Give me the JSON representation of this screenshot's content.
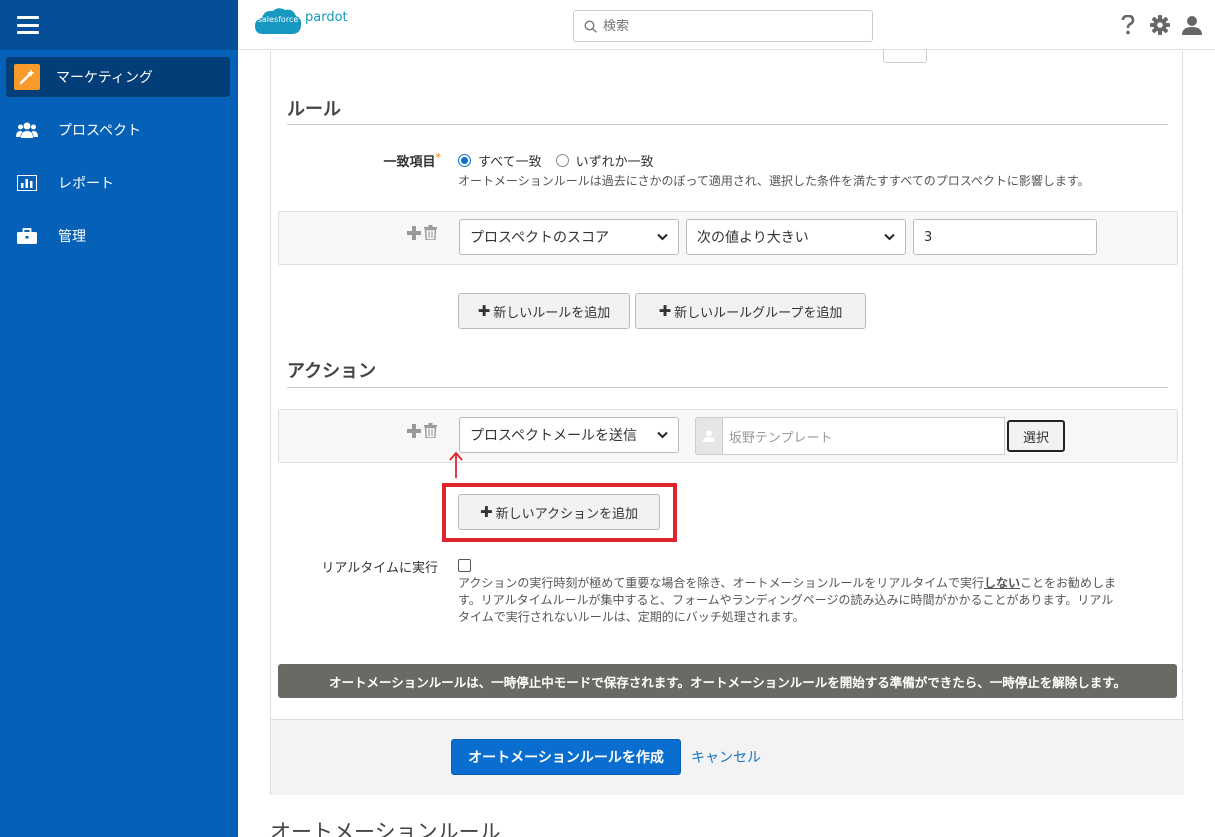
{
  "sidebar": {
    "items": [
      {
        "label": "マーケティング",
        "icon": "magic-wand-icon",
        "active": true
      },
      {
        "label": "プロスペクト",
        "icon": "users-icon",
        "active": false
      },
      {
        "label": "レポート",
        "icon": "bar-chart-icon",
        "active": false
      },
      {
        "label": "管理",
        "icon": "briefcase-icon",
        "active": false
      }
    ]
  },
  "header": {
    "logo_cloud": "salesforce",
    "logo_product": "pardot",
    "search_placeholder": "検索"
  },
  "rules": {
    "title": "ルール",
    "match_label": "一致項目",
    "match_required_mark": "*",
    "match_all": "すべて一致",
    "match_any": "いずれか一致",
    "match_help": "オートメーションルールは過去にさかのぼって適用され、選択した条件を満たすすべてのプロスペクトに影響します。",
    "rule_field": "プロスペクトのスコア",
    "rule_operator": "次の値より大きい",
    "rule_value": "3",
    "add_rule": "新しいルールを追加",
    "add_rule_group": "新しいルールグループを追加"
  },
  "actions": {
    "title": "アクション",
    "action_type": "プロスペクトメールを送信",
    "template_placeholder": "坂野テンプレート",
    "select_button": "選択",
    "add_action": "新しいアクションを追加"
  },
  "realtime": {
    "label": "リアルタイムに実行",
    "help_line1_pre": "アクションの実行時刻が極めて重要な場合を除き、オートメーションルールをリアルタイムで実行",
    "help_line1_bold": "しない",
    "help_line1_post": "ことをお勧めしま",
    "help_line2": "す。リアルタイムルールが集中すると、フォームやランディングページの読み込みに時間がかかることがあります。リアル",
    "help_line3": "タイムで実行されないルールは、定期的にバッチ処理されます。"
  },
  "banner": "オートメーションルールは、一時停止中モードで保存されます。オートメーションルールを開始する準備ができたら、一時停止を解除します。",
  "footer": {
    "create_button": "オートメーションルールを作成",
    "cancel_link": "キャンセル"
  },
  "page_heading": "オートメーションルール",
  "colors": {
    "sidebar": "#0560b7",
    "primary": "#0a6ed1",
    "highlight": "#e0262d",
    "banner": "#6b6963"
  }
}
